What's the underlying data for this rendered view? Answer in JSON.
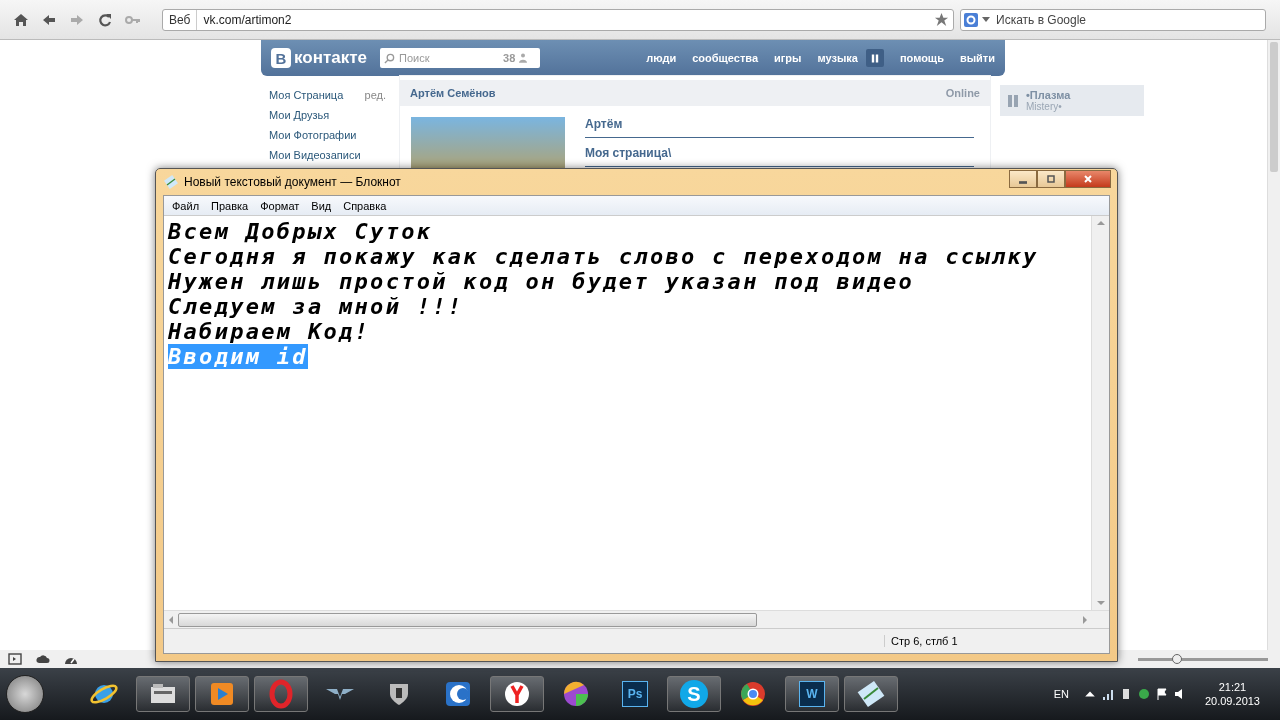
{
  "browser": {
    "address_badge": "Веб",
    "address": "vk.com/artimon2",
    "search_placeholder": "Искать в Google"
  },
  "vk": {
    "logo_letter": "В",
    "logo_text": "контакте",
    "search_placeholder": "Поиск",
    "search_count": "38",
    "nav": [
      {
        "kind": "link",
        "label": "люди"
      },
      {
        "kind": "link",
        "label": "сообщества"
      },
      {
        "kind": "link",
        "label": "игры"
      },
      {
        "kind": "link",
        "label": "музыка"
      },
      {
        "kind": "pause"
      },
      {
        "kind": "link",
        "label": "помощь"
      },
      {
        "kind": "link",
        "label": "выйти"
      }
    ],
    "sidebar": [
      {
        "label": "Моя Страница",
        "extra": "ред."
      },
      {
        "label": "Мои Друзья"
      },
      {
        "label": "Мои Фотографии"
      },
      {
        "label": "Мои Видеозаписи"
      }
    ],
    "profile": {
      "name": "Артём Семёнов",
      "status": "Online",
      "fields": [
        "Артём",
        "Моя страница\\"
      ]
    },
    "player": {
      "title": "•Плазма",
      "artist": "Mistery•"
    }
  },
  "notepad": {
    "title": "Новый текстовый документ — Блокнот",
    "menu": [
      "Файл",
      "Правка",
      "Формат",
      "Вид",
      "Справка"
    ],
    "lines": [
      {
        "text": "Всем Добрых Суток",
        "selected": false
      },
      {
        "text": "Сегодня я покажу как сделать слово с переходом на ссылку",
        "selected": false
      },
      {
        "text": "Нужен лишь простой код он будет указан под видео",
        "selected": false
      },
      {
        "text": "Следуем за мной !!!",
        "selected": false
      },
      {
        "text": "Набираем Код!",
        "selected": false
      },
      {
        "text": "Вводим id",
        "selected": true
      }
    ],
    "status": "Стр 6, стлб 1"
  },
  "zoom_slider": {
    "level": 0.3
  },
  "taskbar": {
    "items": [
      {
        "kind": "ie",
        "open": false
      },
      {
        "kind": "files",
        "open": true
      },
      {
        "kind": "media",
        "open": true
      },
      {
        "kind": "opera",
        "open": true
      },
      {
        "kind": "wings",
        "open": false
      },
      {
        "kind": "tank",
        "open": false
      },
      {
        "kind": "crescent",
        "open": false
      },
      {
        "kind": "yandex",
        "open": true
      },
      {
        "kind": "ball",
        "open": false
      },
      {
        "kind": "tile",
        "label": "Ps",
        "open": false
      },
      {
        "kind": "round",
        "label": "S",
        "open": true
      },
      {
        "kind": "chrome",
        "open": false
      },
      {
        "kind": "tile",
        "label": "W",
        "open": true
      },
      {
        "kind": "notepad",
        "open": true
      }
    ],
    "language": "EN",
    "time": "21:21",
    "date": "20.09.2013"
  }
}
